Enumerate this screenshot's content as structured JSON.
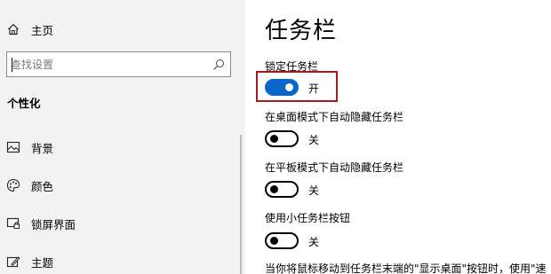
{
  "sidebar": {
    "home_label": "主页",
    "search": {
      "placeholder": "查找设置",
      "value": ""
    },
    "section_heading": "个性化",
    "items": [
      {
        "label": "背景",
        "icon": "image-icon"
      },
      {
        "label": "颜色",
        "icon": "palette-icon"
      },
      {
        "label": "锁屏界面",
        "icon": "lock-screen-icon"
      },
      {
        "label": "主题",
        "icon": "theme-icon"
      }
    ]
  },
  "main": {
    "title": "任务栏",
    "settings": [
      {
        "label": "锁定任务栏",
        "state": "开",
        "on": true,
        "highlighted": true
      },
      {
        "label": "在桌面模式下自动隐藏任务栏",
        "state": "关",
        "on": false
      },
      {
        "label": "在平板模式下自动隐藏任务栏",
        "state": "关",
        "on": false
      },
      {
        "label": "使用小任务栏按钮",
        "state": "关",
        "on": false
      }
    ],
    "footer_text": "当你将鼠标移动到任务栏末端的\"显示桌面\"按钮时，使用\"速"
  },
  "colors": {
    "accent": "#0a67c9",
    "highlight_border": "#a8191e",
    "sidebar_bg": "#f2f2f2"
  }
}
